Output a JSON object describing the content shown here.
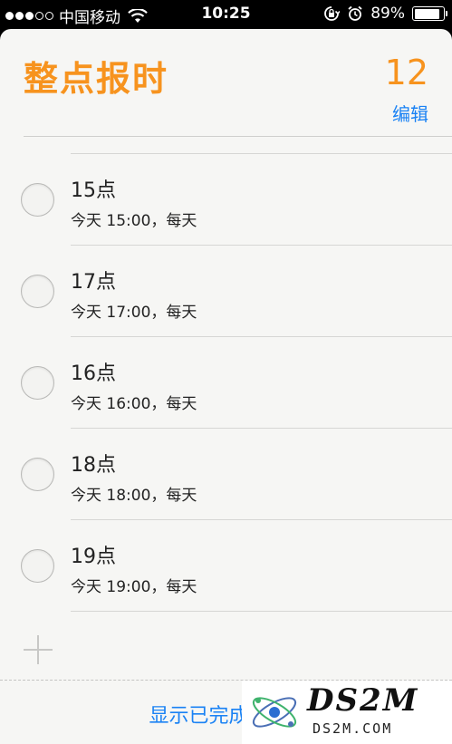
{
  "status_bar": {
    "carrier": "中国移动",
    "time": "10:25",
    "battery": "89%",
    "battery_level": 0.89,
    "signal_dots": [
      true,
      true,
      true,
      false,
      false
    ]
  },
  "header": {
    "title": "整点报时",
    "count": "12",
    "edit_label": "编辑"
  },
  "colors": {
    "accent_orange": "#f7931e",
    "link_blue": "#1a82f4"
  },
  "items": [
    {
      "title": "15点",
      "subtitle": "今天 15:00，每天"
    },
    {
      "title": "17点",
      "subtitle": "今天 17:00，每天"
    },
    {
      "title": "16点",
      "subtitle": "今天 16:00，每天"
    },
    {
      "title": "18点",
      "subtitle": "今天 18:00，每天"
    },
    {
      "title": "19点",
      "subtitle": "今天 19:00，每天"
    }
  ],
  "footer": {
    "show_completed_label": "显示已完成"
  },
  "watermark": {
    "brand": "DS2M",
    "url": "DS2M.COM"
  }
}
